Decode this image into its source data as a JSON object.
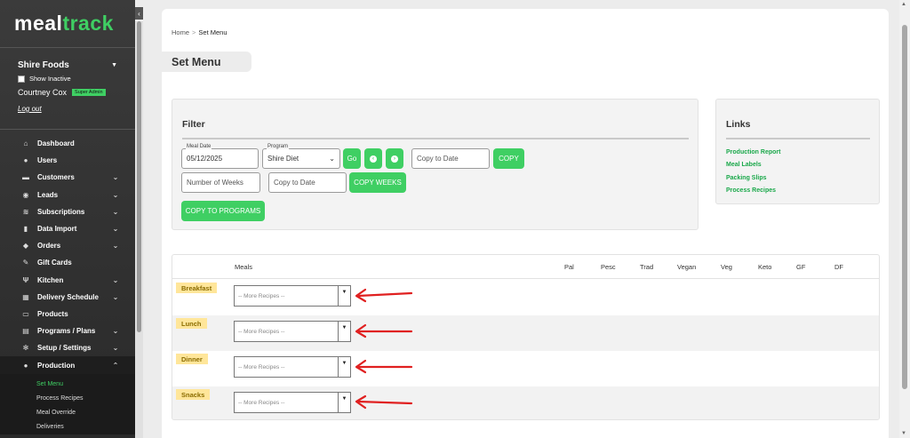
{
  "brand": {
    "part1": "meal",
    "part2": "track"
  },
  "account": {
    "company": "Shire Foods",
    "show_inactive_label": "Show Inactive",
    "user_name": "Courtney Cox",
    "role_badge": "Super Admin",
    "logout": "Log out"
  },
  "nav": [
    {
      "label": "Dashboard",
      "icon": "home-icon"
    },
    {
      "label": "Users",
      "icon": "user-icon"
    },
    {
      "label": "Customers",
      "icon": "customers-icon"
    },
    {
      "label": "Leads",
      "icon": "leads-icon"
    },
    {
      "label": "Subscriptions",
      "icon": "layers-icon"
    },
    {
      "label": "Data Import",
      "icon": "file-icon"
    },
    {
      "label": "Orders",
      "icon": "bag-icon"
    },
    {
      "label": "Gift Cards",
      "icon": "wrench-icon"
    },
    {
      "label": "Kitchen",
      "icon": "utensils-icon"
    },
    {
      "label": "Delivery Schedule",
      "icon": "calendar-icon"
    },
    {
      "label": "Products",
      "icon": "box-icon"
    },
    {
      "label": "Programs / Plans",
      "icon": "clipboard-icon"
    },
    {
      "label": "Setup / Settings",
      "icon": "gear-icon"
    },
    {
      "label": "Production",
      "icon": "person-icon"
    }
  ],
  "production_sub": [
    "Set Menu",
    "Process Recipes",
    "Meal Override",
    "Deliveries"
  ],
  "breadcrumb": {
    "home": "Home",
    "separator": ">",
    "current": "Set Menu"
  },
  "page_title": "Set Menu",
  "filter": {
    "title": "Filter",
    "meal_date_label": "Meal Date",
    "meal_date_value": "05/12/2025",
    "program_label": "Program",
    "program_value": "Shire Diet",
    "go_label": "Go",
    "copy_to_date_placeholder": "Copy to Date",
    "copy_label": "COPY",
    "number_of_weeks_placeholder": "Number of Weeks",
    "copy_to_date2_placeholder": "Copy to Date",
    "copy_weeks_label": "COPY WEEKS",
    "copy_to_programs_label": "COPY TO PROGRAMS"
  },
  "links": {
    "title": "Links",
    "items": [
      "Production Report",
      "Meal Labels",
      "Packing Slips",
      "Process Recipes"
    ]
  },
  "table": {
    "headers": [
      "Meals",
      "Pal",
      "Pesc",
      "Trad",
      "Vegan",
      "Veg",
      "Keto",
      "GF",
      "DF"
    ],
    "rows": [
      {
        "meal": "Breakfast",
        "select": "-- More Recipes --"
      },
      {
        "meal": "Lunch",
        "select": "-- More Recipes --"
      },
      {
        "meal": "Dinner",
        "select": "-- More Recipes --"
      },
      {
        "meal": "Snacks",
        "select": "-- More Recipes --"
      }
    ]
  },
  "colors": {
    "accent": "#3fcf63",
    "sidebar": "#333333",
    "meal_tag": "#ffe69a",
    "arrow": "#e02020"
  }
}
